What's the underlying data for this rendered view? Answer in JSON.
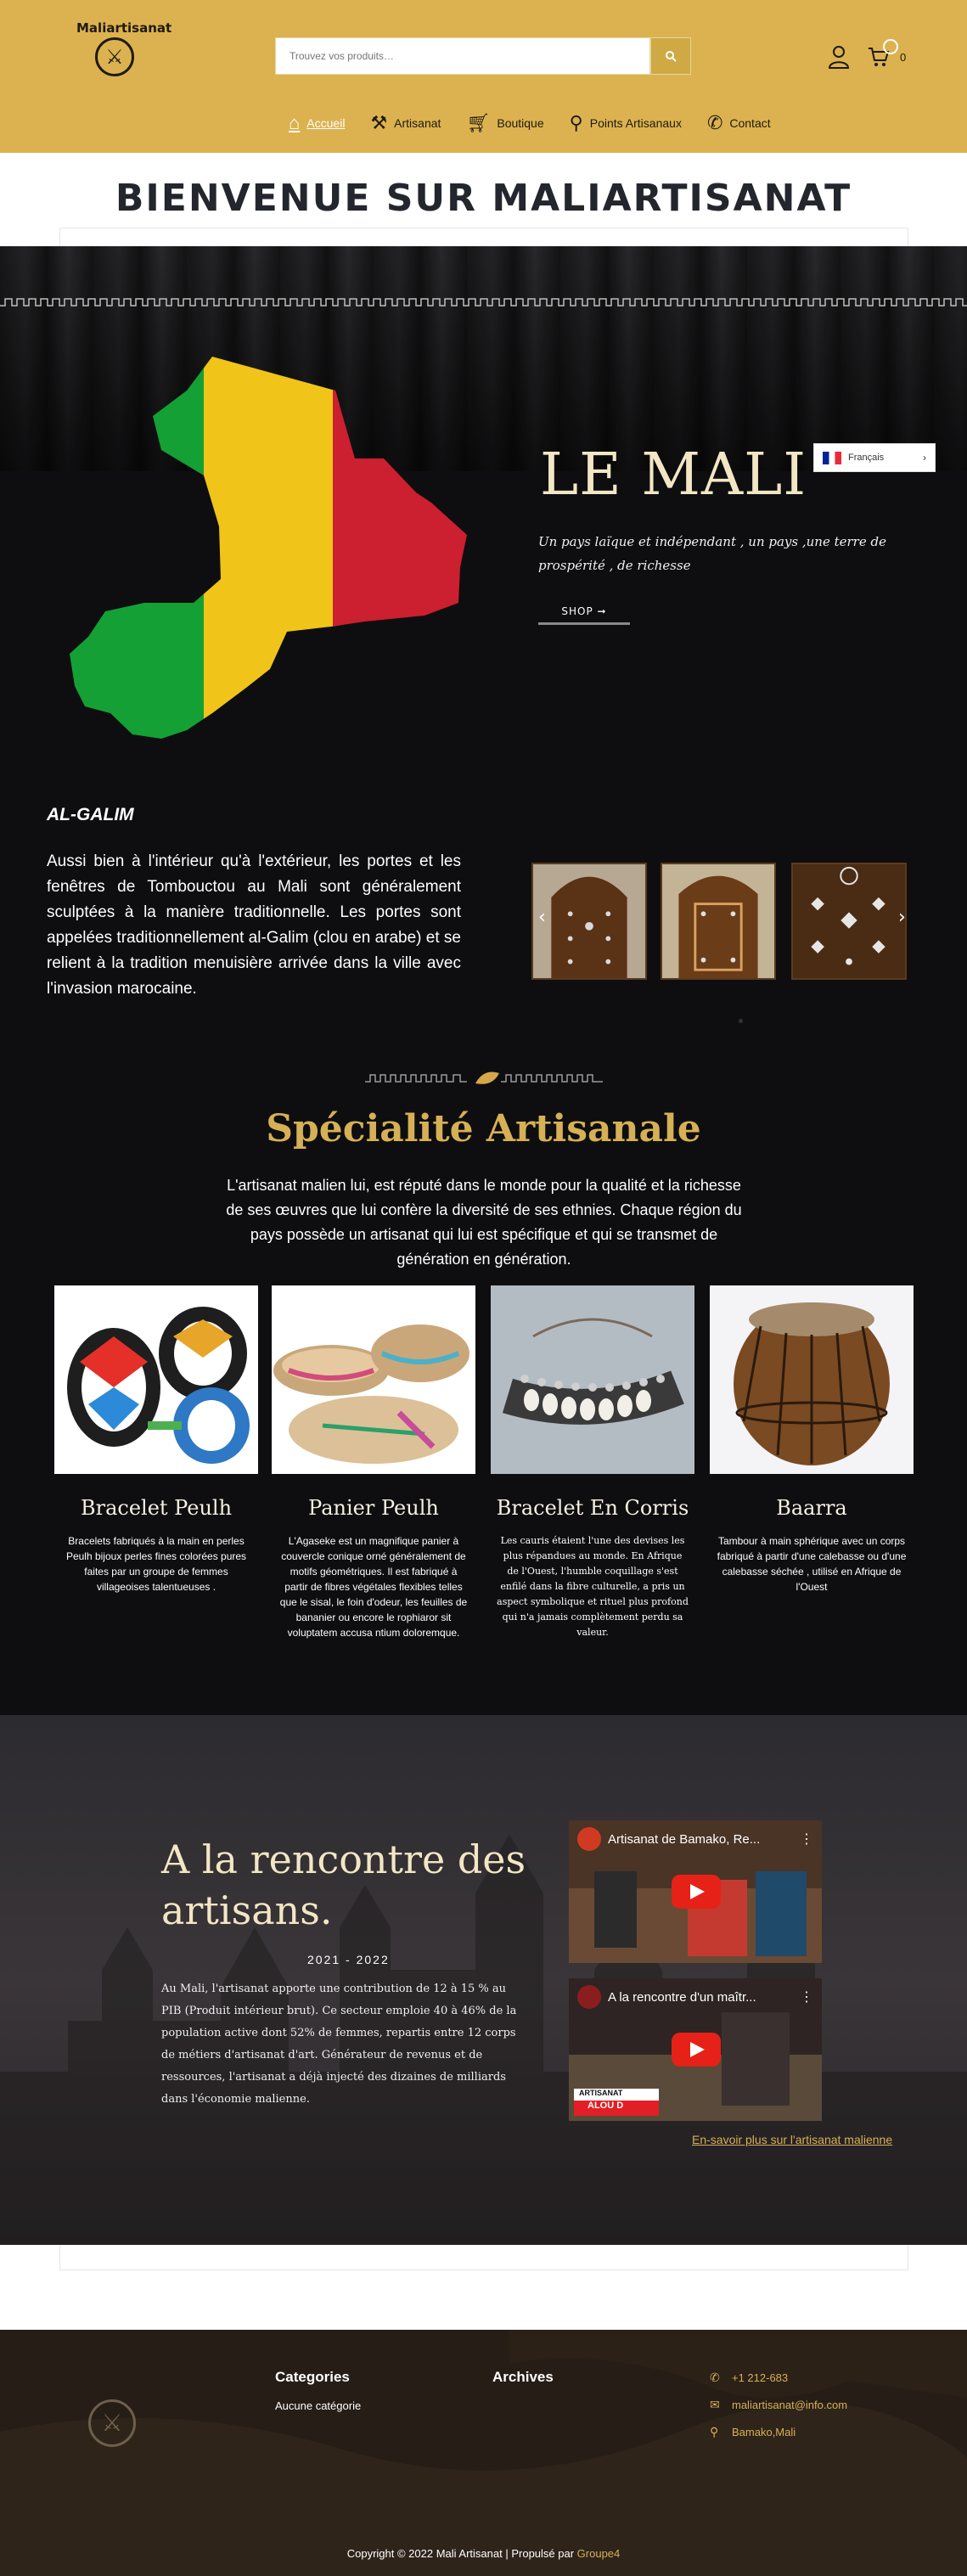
{
  "header": {
    "logo_text": "Maliartisanat",
    "search_placeholder": "Trouvez vos produits…",
    "cart_count": "0",
    "nav": [
      {
        "label": "Accueil",
        "icon": "home-icon"
      },
      {
        "label": "Artisanat",
        "icon": "hammer-icon"
      },
      {
        "label": "Boutique",
        "icon": "cart-icon"
      },
      {
        "label": "Points Artisanaux",
        "icon": "map-pin-icon"
      },
      {
        "label": "Contact",
        "icon": "phone-icon"
      }
    ]
  },
  "welcome": {
    "title": "BIENVENUE SUR MALIARTISANAT"
  },
  "hero": {
    "title": "LE MALI",
    "subtitle": "Un pays laïque et indépendant , un pays ,une terre de prospérité , de richesse",
    "shop_label": "SHOP ➞",
    "language": "Français",
    "flag_colors": [
      "#14a035",
      "#f0c419",
      "#cc1f2f"
    ]
  },
  "galim": {
    "title": "AL-GALIM",
    "text": "Aussi bien à l'intérieur qu'à l'extérieur, les portes et les fenêtres de Tombouctou au Mali sont généralement sculptées à la manière traditionnelle. Les portes sont appelées traditionnellement al-Galim (clou en arabe) et se relient à la tradition menuisière arrivée dans la ville avec l'invasion marocaine."
  },
  "specialite": {
    "title": "Spécialité Artisanale",
    "intro": "L'artisanat malien lui, est réputé dans le monde pour la qualité et la richesse de ses œuvres que lui confère la diversité de ses ethnies. Chaque région du pays possède un artisanat qui lui est spécifique et qui se transmet de génération en génération.",
    "cards": [
      {
        "title": "Bracelet Peulh",
        "text": "Bracelets fabriqués à la main en perles Peulh bijoux perles fines colorées pures faites par un groupe de femmes villageoises talentueuses ."
      },
      {
        "title": "Panier Peulh",
        "text": "L'Agaseke est un magnifique panier à couvercle conique orné généralement de motifs géométriques. Il est fabriqué à partir de fibres végétales flexibles telles que le sisal, le foin d'odeur, les feuilles de bananier ou encore le rophiaror sit voluptatem accusa ntium doloremque."
      },
      {
        "title": "Bracelet En Corris",
        "text": "Les cauris étaient l'une des devises les plus répandues au monde. En Afrique de l'Ouest, l'humble coquillage s'est enfilé dans la fibre culturelle, a pris un aspect symbolique et rituel plus profond qui n'a jamais complètement perdu sa valeur."
      },
      {
        "title": "Baarra",
        "text": "Tambour à main sphérique avec un corps fabriqué à partir d'une calebasse ou d'une calebasse séchée , utilisé en Afrique de l'Ouest"
      }
    ]
  },
  "meet": {
    "title": "A la rencontre des artisans.",
    "date": "2021 - 2022",
    "text": "Au Mali, l'artisanat apporte une contribution de 12 à 15 % au PIB (Produit intérieur brut). Ce secteur emploie 40 à 46% de la population active dont 52% de femmes, repartis entre 12 corps de métiers d'artisanat d'art. Générateur de revenus et de ressources, l'artisanat a déjà injecté des dizaines de milliards dans l'économie malienne.",
    "videos": [
      {
        "title": "Artisanat de Bamako, Re..."
      },
      {
        "title": "A la rencontre d'un maîtr..."
      }
    ],
    "video2_caption": "ARTISANAT",
    "video2_caption2": "ALOU D",
    "link": "En-savoir plus sur l'artisanat malienne"
  },
  "footer": {
    "categories_title": "Categories",
    "categories_empty": "Aucune catégorie",
    "archives_title": "Archives",
    "phone": "+1 212-683",
    "email": "maliartisanat@info.com",
    "address": "Bamako,Mali",
    "copyright": "Copyright © 2022 Mali Artisanat | Propulsé par",
    "brand": "Groupe4"
  },
  "colors": {
    "accent": "#dcb250",
    "gold_text": "#d6b055",
    "dark_bg": "#0e0e10"
  }
}
